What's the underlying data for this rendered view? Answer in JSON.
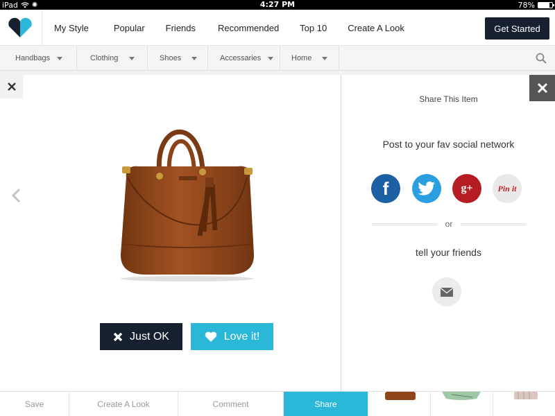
{
  "status_bar": {
    "device": "iPad",
    "time": "4:27 PM",
    "battery": "78%",
    "battery_level": 0.78
  },
  "header": {
    "nav": [
      {
        "label": "My Style"
      },
      {
        "label": "Popular"
      },
      {
        "label": "Friends"
      },
      {
        "label": "Recommended"
      },
      {
        "label": "Top 10"
      },
      {
        "label": "Create A Look"
      }
    ],
    "cta_label": "Get Started"
  },
  "subnav": {
    "categories": [
      {
        "label": "Handbags"
      },
      {
        "label": "Clothing"
      },
      {
        "label": "Shoes"
      },
      {
        "label": "Accessaries"
      },
      {
        "label": "Home"
      }
    ]
  },
  "product": {
    "just_ok_label": "Just OK",
    "love_label": "Love it!"
  },
  "share_panel": {
    "title": "Share This Item",
    "post_text": "Post to your fav social network",
    "networks": [
      {
        "name": "facebook",
        "glyph": "f"
      },
      {
        "name": "twitter",
        "glyph": ""
      },
      {
        "name": "google-plus",
        "glyph": "g+"
      },
      {
        "name": "pinterest",
        "glyph": "Pin it"
      }
    ],
    "or_label": "or",
    "tell_text": "tell your friends"
  },
  "bottom_bar": {
    "tabs": [
      {
        "label": "Save"
      },
      {
        "label": "Create A Look"
      },
      {
        "label": "Comment"
      },
      {
        "label": "Share"
      }
    ]
  },
  "colors": {
    "accent": "#2bb7d8",
    "dark": "#16202e"
  }
}
